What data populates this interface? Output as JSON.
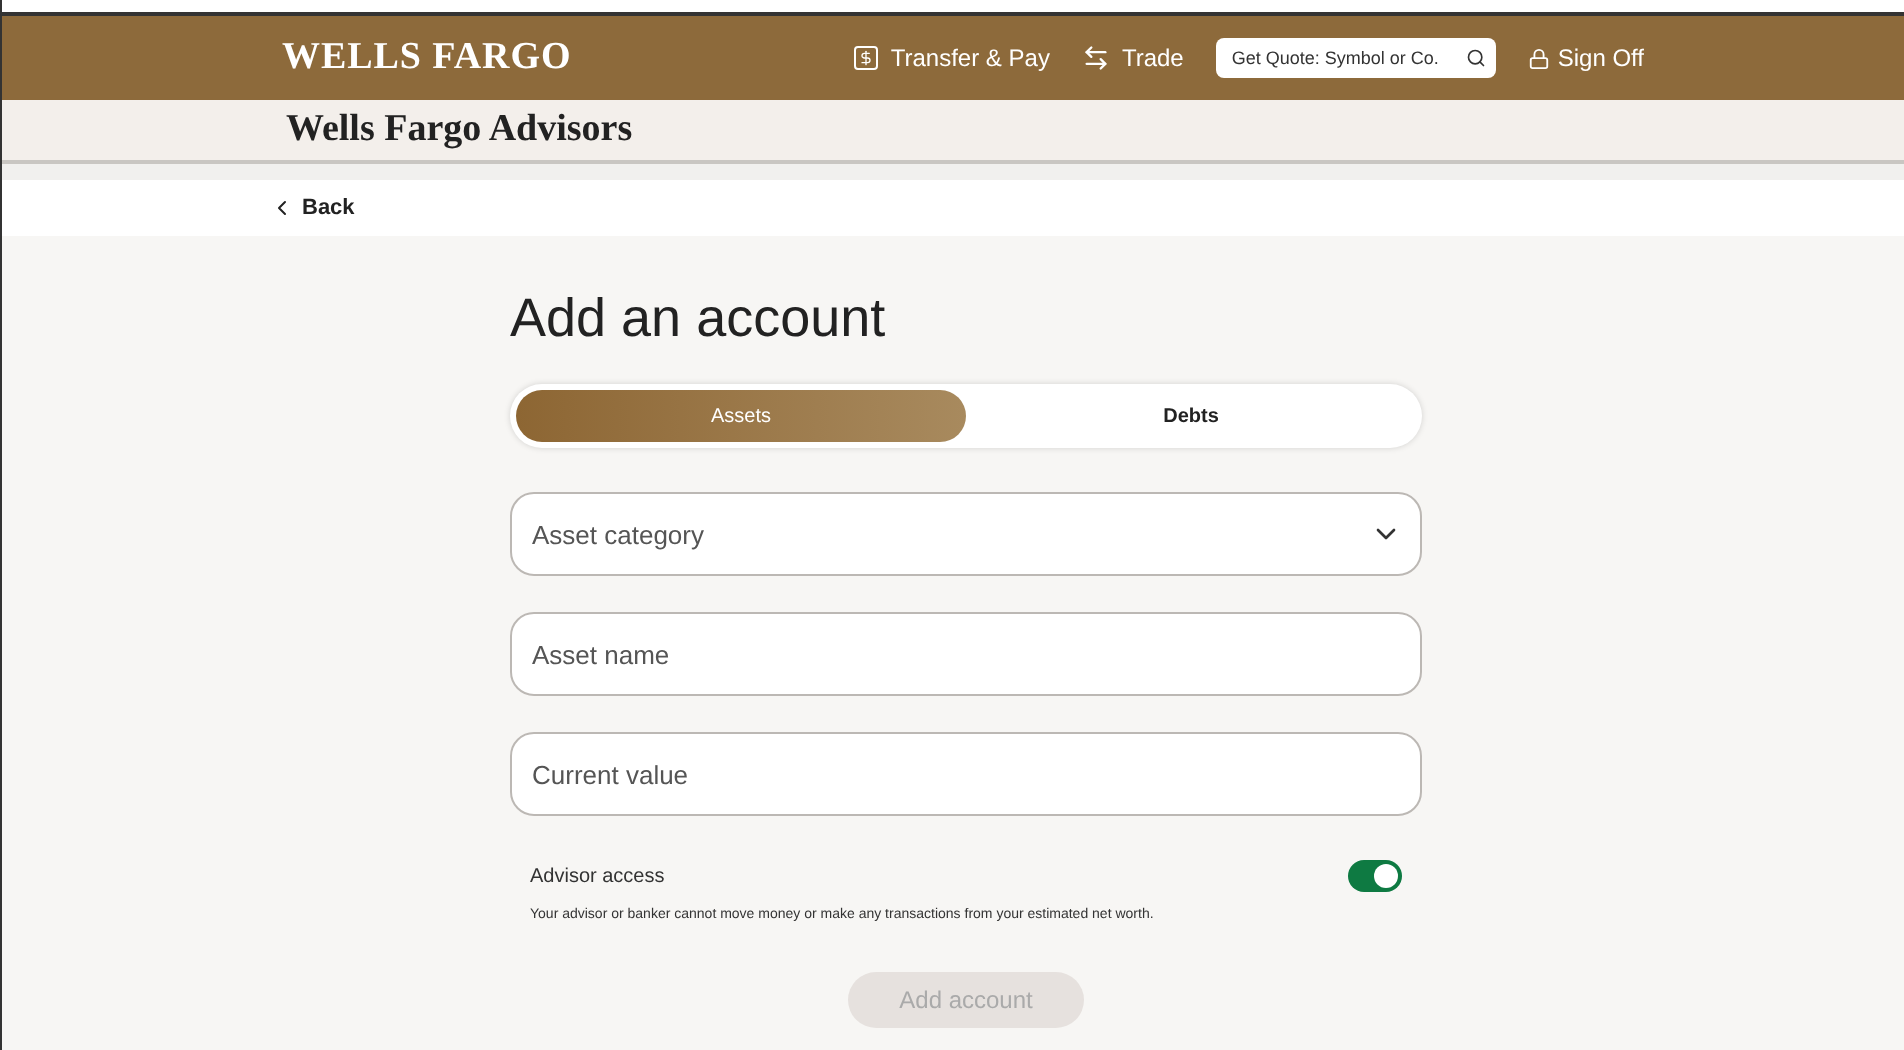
{
  "header": {
    "logo": "WELLS FARGO",
    "nav": [
      {
        "kind": "transfer",
        "label": "Transfer & Pay"
      },
      {
        "kind": "trade",
        "label": "Trade"
      }
    ],
    "search": {
      "placeholder": "Get Quote: Symbol or Co."
    },
    "sign_off": "Sign Off"
  },
  "subheader": {
    "title": "Wells Fargo Advisors"
  },
  "back": {
    "label": "Back"
  },
  "form": {
    "title": "Add an account",
    "tabs": [
      {
        "label": "Assets",
        "selected": true
      },
      {
        "label": "Debts",
        "selected": false
      }
    ],
    "fields": [
      {
        "kind": "select",
        "placeholder": "Asset category"
      },
      {
        "kind": "text",
        "placeholder": "Asset name"
      },
      {
        "kind": "text",
        "placeholder": "Current value"
      }
    ],
    "advisor_access": {
      "label": "Advisor access",
      "on": true,
      "note": "Your advisor or banker cannot move money or make any transactions from your estimated net worth."
    },
    "submit": {
      "label": "Add account",
      "disabled": true
    }
  }
}
